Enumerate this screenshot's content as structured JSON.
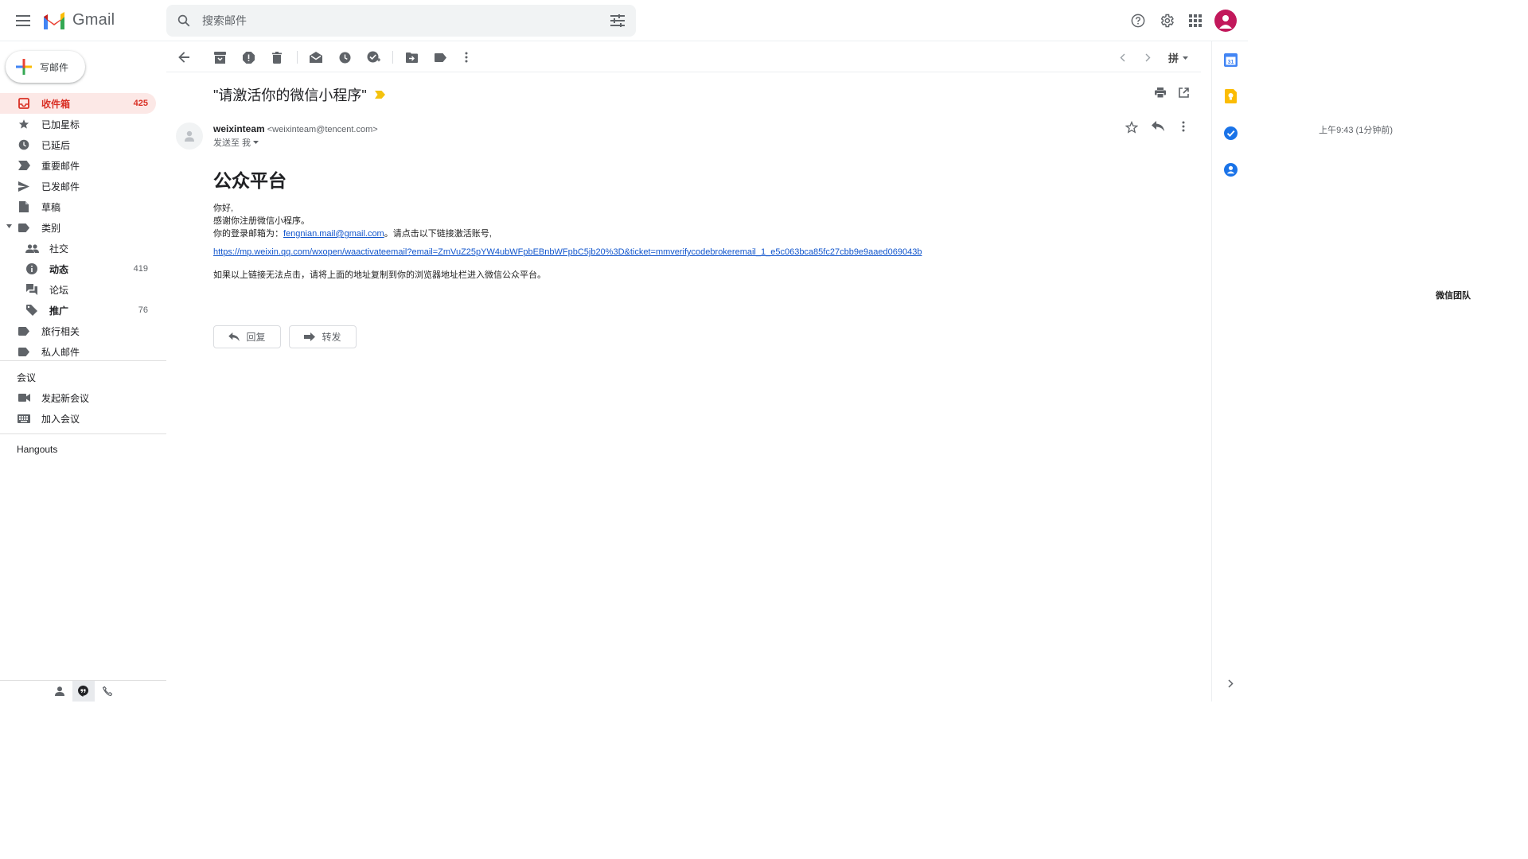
{
  "header": {
    "app_name": "Gmail",
    "search_placeholder": "搜索邮件",
    "account_initial": ""
  },
  "sidebar": {
    "compose_label": "写邮件",
    "items": [
      {
        "label": "收件箱",
        "count": "425",
        "icon": "inbox-icon"
      },
      {
        "label": "已加星标",
        "count": "",
        "icon": "star-icon"
      },
      {
        "label": "已延后",
        "count": "",
        "icon": "clock-icon"
      },
      {
        "label": "重要邮件",
        "count": "",
        "icon": "label-important-icon"
      },
      {
        "label": "已发邮件",
        "count": "",
        "icon": "send-icon"
      },
      {
        "label": "草稿",
        "count": "",
        "icon": "draft-icon"
      },
      {
        "label": "类别",
        "count": "",
        "icon": "label-icon"
      },
      {
        "label": "社交",
        "count": "",
        "icon": "people-icon"
      },
      {
        "label": "动态",
        "count": "419",
        "icon": "info-icon"
      },
      {
        "label": "论坛",
        "count": "",
        "icon": "forum-icon"
      },
      {
        "label": "推广",
        "count": "76",
        "icon": "tag-icon"
      },
      {
        "label": "旅行相关",
        "count": "",
        "icon": "label-icon"
      },
      {
        "label": "私人邮件",
        "count": "",
        "icon": "label-icon"
      }
    ],
    "meet_title": "会议",
    "meet_new": "发起新会议",
    "meet_join": "加入会议",
    "hangouts_title": "Hangouts"
  },
  "toolbar": {
    "input_lang": "拼"
  },
  "email": {
    "subject": "\"请激活你的微信小程序\"",
    "sender_name": "weixinteam",
    "sender_addr": "<weixinteam@tencent.com>",
    "to_line": "发送至 我",
    "time": "上午9:43 (1分钟前)",
    "body_title": "公众平台",
    "greeting": "你好,",
    "thanks": "感谢你注册微信小程序。",
    "login_prefix": "你的登录邮箱为：",
    "login_email": "fengnian.mail@gmail.com",
    "login_suffix": "。请点击以下链接激活账号,",
    "activation_link": "https://mp.weixin.qq.com/wxopen/waactivateemail?email=ZmVuZ25pYW4ubWFpbEBnbWFpbC5jb20%3D&ticket=mmverifycodebrokeremail_1_e5c063bca85fc27cbb9e9aaed069043b",
    "note": "如果以上链接无法点击，请将上面的地址复制到你的浏览器地址栏进入微信公众平台。",
    "signature": "微信团队",
    "reply_label": "回复",
    "forward_label": "转发"
  },
  "colors": {
    "accent_red": "#d93025",
    "active_bg": "#fce8e6",
    "link_blue": "#1155cc",
    "avatar": "#c2185b"
  }
}
